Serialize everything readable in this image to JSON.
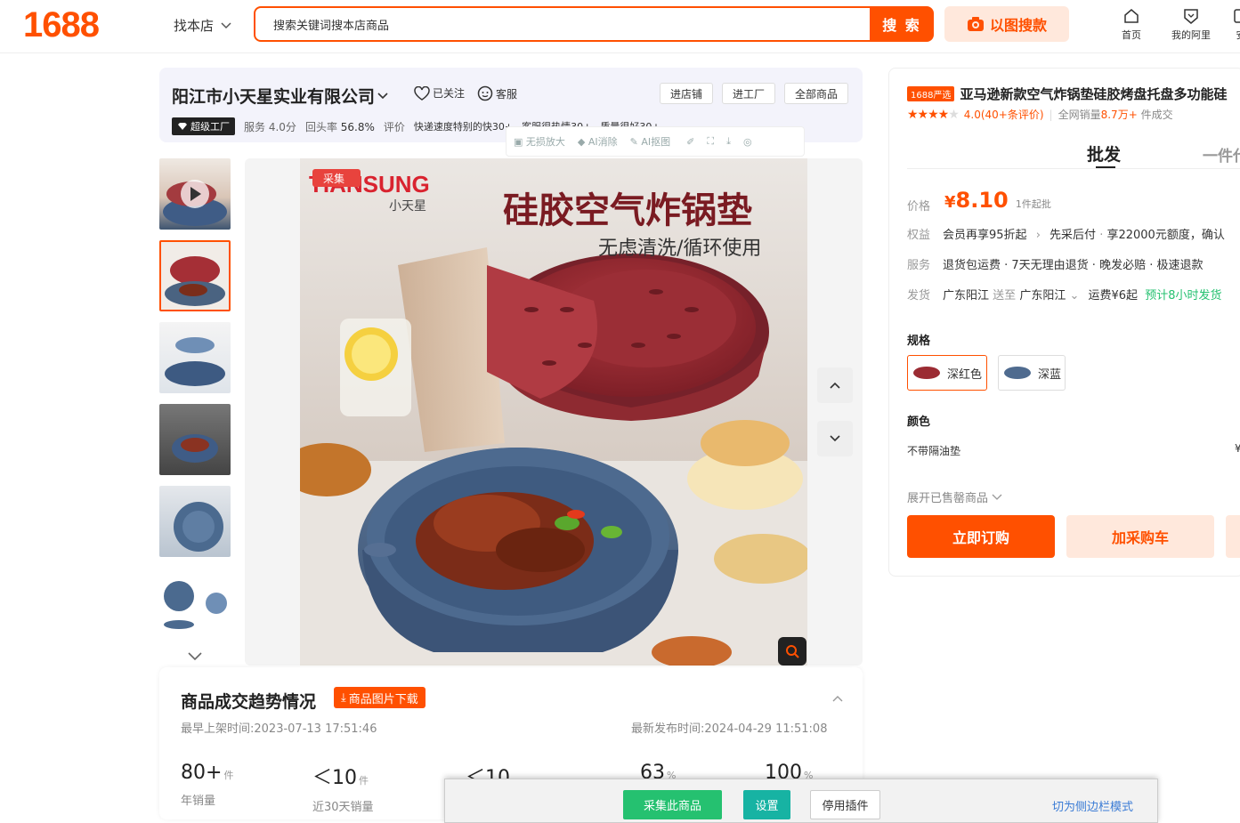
{
  "header": {
    "logo": "1688",
    "find_shop": "找本店",
    "search_placeholder": "搜索关键词搜本店商品",
    "search_button": "搜 索",
    "image_search": "以图搜款",
    "nav": [
      {
        "label": "首页",
        "icon": "home-icon"
      },
      {
        "label": "我的阿里",
        "icon": "heart-shield-icon"
      },
      {
        "label": "安",
        "icon": "app-icon"
      }
    ]
  },
  "shop": {
    "name": "阳江市小天星实业有限公司",
    "followed": "已关注",
    "service": "客服",
    "buttons": [
      "进店铺",
      "进工厂",
      "全部商品"
    ],
    "badge": "超级工厂",
    "score_label": "服务",
    "score": "4.0分",
    "repurchase_label": "回头率",
    "repurchase": "56.8%",
    "review_label": "评价",
    "tags": [
      "快递速度特别的快30+",
      "客服很热情30+",
      "质量很好30+"
    ]
  },
  "plugin_toolbar": [
    "无损放大",
    "AI消除",
    "AI抠图"
  ],
  "product_image": {
    "brand": "TIANSUNG",
    "brand_cn": "小天星",
    "collect_tag": "采集",
    "headline": "硅胶空气炸锅垫",
    "subline": "无虑清洗/循环使用"
  },
  "trend": {
    "title": "商品成交趋势情况",
    "download": "商品图片下载",
    "first_listed_label": "最早上架时间:",
    "first_listed": "2023-07-13 17:51:46",
    "latest_label": "最新发布时间:",
    "latest": "2024-04-29 11:51:08",
    "stats": [
      {
        "value": "80+",
        "unit": "件",
        "label": "年销量"
      },
      {
        "value": "＜10",
        "unit": "件",
        "label": "近30天销量"
      },
      {
        "value": "＜10",
        "unit": "",
        "label": ""
      },
      {
        "value": "63",
        "unit": "%",
        "label": ""
      },
      {
        "value": "100",
        "unit": "%",
        "label": ""
      }
    ]
  },
  "product": {
    "tag": "1688严选",
    "title": "亚马逊新款空气炸锅垫硅胶烤盘托盘多功能硅",
    "rating": "4.0(40+条评价)",
    "sales_label": "全网销量",
    "sales": "8.7万+",
    "sales_suffix": "件成交",
    "tabs": [
      "批发",
      "一件代"
    ],
    "price_label": "价格",
    "price_symbol": "¥",
    "price": "8.10",
    "moq": "1件起批",
    "benefit_label": "权益",
    "benefit": "会员再享95折起",
    "benefit_2": "先采后付",
    "benefit_3": "享22000元额度，确认",
    "service_label": "服务",
    "services": "退货包运费 · 7天无理由退货 · 晚发必赔 · 极速退款",
    "ship_label": "发货",
    "ship_from": "广东阳江",
    "ship_to_word": "送至",
    "ship_to": "广东阳江",
    "freight": "运费¥6起",
    "ship_time": "预计8小时发货",
    "spec_label": "规格",
    "specs": [
      "深红色",
      "深蓝"
    ],
    "color_label": "颜色",
    "color_option": "不带隔油垫",
    "expand": "展开已售罄商品",
    "buy_now": "立即订购",
    "add_cart": "加采购车"
  },
  "plugin_bar": {
    "collect": "采集此商品",
    "settings": "设置",
    "disable": "停用插件",
    "sidebar_mode": "切为侧边栏模式"
  },
  "colors": {
    "brand": "#ff5000",
    "green": "#25c170",
    "teal": "#17b3a3"
  }
}
